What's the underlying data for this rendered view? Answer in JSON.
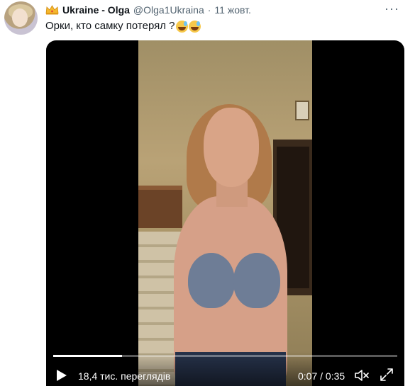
{
  "tweet": {
    "display_name": "Ukraine - Olga",
    "handle": "@Olga1Ukraina",
    "separator": "·",
    "date": "11 жовт.",
    "more_icon": "more-dots-icon",
    "text": "Орки, кто самку потерял ?",
    "emojis": [
      "grinning-sweat-emoji",
      "grinning-sweat-emoji"
    ]
  },
  "video": {
    "views": "18,4 тис. переглядів",
    "time": "0:07 / 0:35",
    "progress": 0.2,
    "play_icon": "play-icon",
    "mute_icon": "mute-icon",
    "fullscreen_icon": "fullscreen-icon"
  },
  "colors": {
    "name": "#0f1419",
    "secondary": "#536471",
    "video_bg": "#000000"
  }
}
